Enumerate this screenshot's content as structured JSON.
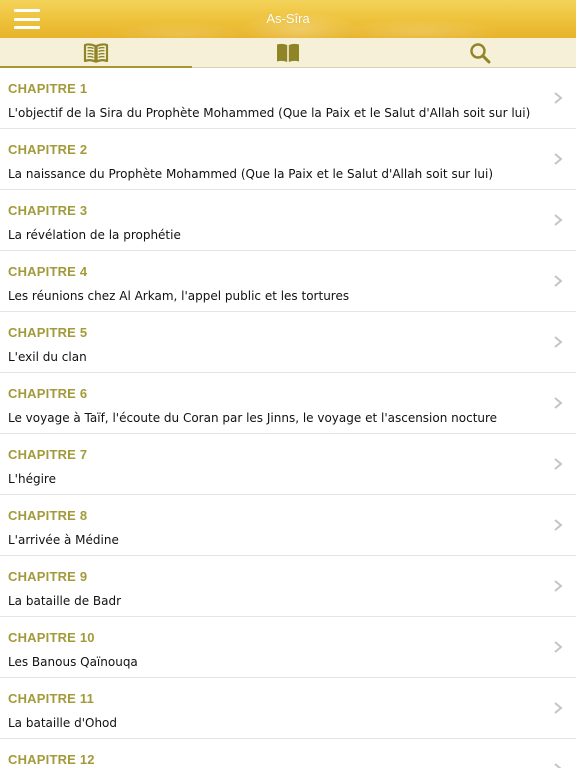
{
  "header": {
    "title": "As-Sîra"
  },
  "colors": {
    "accent": "#a39a3a",
    "navbar": "#eec13a",
    "tabbar": "#f6f0d9"
  },
  "tabs": [
    {
      "icon": "open-book-icon",
      "active": true
    },
    {
      "icon": "closed-book-icon",
      "active": false
    },
    {
      "icon": "search-icon",
      "active": false
    }
  ],
  "chapters": [
    {
      "label": "CHAPITRE 1",
      "title": "L'objectif de la Sira du Prophète Mohammed (Que la Paix et le Salut d'Allah soit sur lui)"
    },
    {
      "label": "CHAPITRE 2",
      "title": "La naissance du Prophète Mohammed (Que la Paix et le Salut d'Allah soit sur lui)"
    },
    {
      "label": "CHAPITRE 3",
      "title": "La révélation de la prophétie"
    },
    {
      "label": "CHAPITRE 4",
      "title": "Les réunions chez Al Arkam, l'appel public et les tortures"
    },
    {
      "label": "CHAPITRE 5",
      "title": "L'exil du clan"
    },
    {
      "label": "CHAPITRE 6",
      "title": "Le voyage à Taïf, l'écoute du Coran par les Jinns, le voyage et l'ascension nocture"
    },
    {
      "label": "CHAPITRE 7",
      "title": "L'hégire"
    },
    {
      "label": "CHAPITRE 8",
      "title": "L'arrivée à Médine"
    },
    {
      "label": "CHAPITRE 9",
      "title": "La bataille de Badr"
    },
    {
      "label": "CHAPITRE 10",
      "title": "Les Banous Qaïnouqa"
    },
    {
      "label": "CHAPITRE 11",
      "title": "La bataille d'Ohod"
    },
    {
      "label": "CHAPITRE 12",
      "title": ""
    }
  ]
}
